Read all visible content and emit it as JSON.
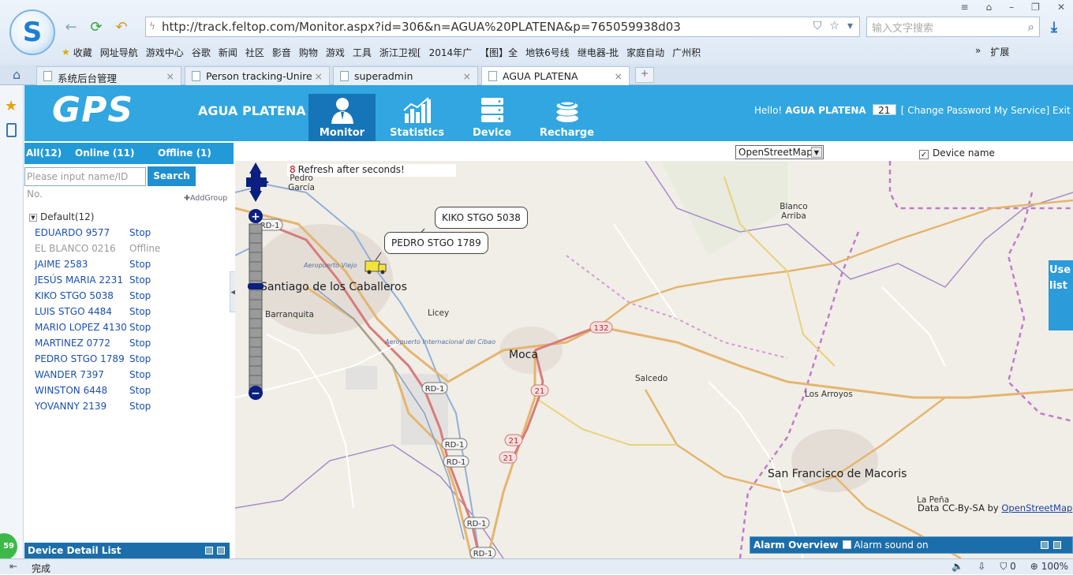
{
  "browser": {
    "url": "http://track.feltop.com/Monitor.aspx?id=306&n=AGUA%20PLATENA&p=765059938d03",
    "search_placeholder": "输入文字搜索",
    "bookmarks": [
      "收藏",
      "网址导航",
      "游戏中心",
      "谷歌",
      "新闻",
      "社区",
      "影音",
      "购物",
      "游戏",
      "工具",
      "浙江卫视[",
      "2014年广",
      "【图】全",
      "地铁6号线",
      "继电器-批",
      "家庭自动",
      "广州积"
    ],
    "bookmark_more": "»",
    "extensions_label": "扩展",
    "tabs": [
      "系统后台管理",
      "Person tracking-Unire",
      "superadmin",
      "AGUA PLATENA"
    ],
    "status_text": "完成",
    "status_counts": {
      "shield": "0",
      "zoom": "100%"
    }
  },
  "app": {
    "logo": "GPS",
    "account_name": "AGUA PLATENA",
    "nav": [
      "Monitor",
      "Statistics",
      "Device",
      "Recharge"
    ],
    "hello": "Hello!",
    "user": "AGUA PLATENA",
    "counter": "21",
    "links": "[ Change Password  My Service] Exit"
  },
  "sidebar": {
    "filters": {
      "all": "All(12)",
      "online": "Online (11)",
      "offline": "Offline (1)"
    },
    "search_placeholder": "Please input name/ID No.",
    "search_button": "Search",
    "add_group": "AddGroup",
    "group": "Default(12)",
    "devices": [
      {
        "name": "EDUARDO 9577",
        "status": "Stop"
      },
      {
        "name": "EL BLANCO 0216",
        "status": "Offline"
      },
      {
        "name": "JAIME 2583",
        "status": "Stop"
      },
      {
        "name": "JESÚS MARIA 2231",
        "status": "Stop"
      },
      {
        "name": "KIKO STGO 5038",
        "status": "Stop"
      },
      {
        "name": "LUIS STGO 4484",
        "status": "Stop"
      },
      {
        "name": "MARIO LOPEZ 4130",
        "status": "Stop"
      },
      {
        "name": "MARTINEZ 0772",
        "status": "Stop"
      },
      {
        "name": "PEDRO STGO 1789",
        "status": "Stop"
      },
      {
        "name": "WANDER 7397",
        "status": "Stop"
      },
      {
        "name": "WINSTON 6448",
        "status": "Stop"
      },
      {
        "name": "YOVANNY 2139",
        "status": "Stop"
      }
    ],
    "detail_list": "Device Detail List"
  },
  "map": {
    "layer": "OpenStreetMap",
    "device_name_toggle": "Device name",
    "refresh_count": "8",
    "refresh_text": "Refresh after seconds!",
    "callouts": [
      "KIKO STGO 5038",
      "PEDRO STGO 1789"
    ],
    "cities": [
      "Santiago de los Caballeros",
      "Moca",
      "San Francisco de Macoris"
    ],
    "towns": [
      "Pedro García",
      "Blanco Arriba",
      "Barranquita",
      "Licey",
      "Salcedo",
      "Los Arroyos",
      "La Peña"
    ],
    "airports": [
      "Aeropuerto Viejo",
      "Aeropuerto Internacional del Cibao"
    ],
    "road_shields": [
      "RD-1",
      "RD-1",
      "RD-1",
      "RD-1",
      "RD-1",
      "RD-1",
      "132",
      "21",
      "21",
      "21"
    ],
    "credit_prefix": "Data CC-By-SA by",
    "credit_link": "OpenStreetMap",
    "user_tab": "Use list",
    "alarm_title": "Alarm Overview",
    "alarm_sound": "Alarm sound on"
  },
  "badge": "59"
}
